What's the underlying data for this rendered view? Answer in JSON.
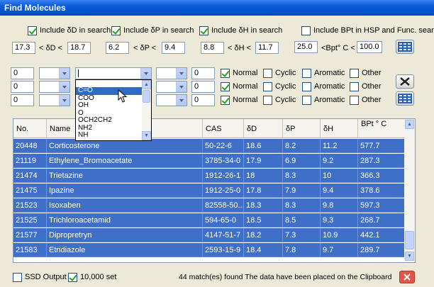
{
  "window": {
    "title": "Find Molecules"
  },
  "options": {
    "include_d": "Include δD in search",
    "include_p": "Include δP in search",
    "include_h": "Include δH in search",
    "include_bpt": "Include BPt in HSP and Func. search"
  },
  "ranges": {
    "d_min": "17.3",
    "d_label": "< δD <",
    "d_max": "18.7",
    "p_min": "6.2",
    "p_label": "< δP <",
    "p_max": "9.4",
    "h_min": "8.8",
    "h_label": "< δH <",
    "h_max": "11.7",
    "bpt_min": "25.0",
    "bpt_label": "<Bpt° C <",
    "bpt_max": "100.0"
  },
  "groups": [
    {
      "count": "0",
      "group": "",
      "count2": "0",
      "normal": "Normal",
      "cyclic": "Cyclic",
      "aromatic": "Aromatic",
      "other": "Other"
    },
    {
      "count": "0",
      "group": "",
      "count2": "0",
      "normal": "Normal",
      "cyclic": "Cyclic",
      "aromatic": "Aromatic",
      "other": "Other"
    },
    {
      "count": "0",
      "group": "",
      "count2": "0",
      "normal": "Normal",
      "cyclic": "Cyclic",
      "aromatic": "Aromatic",
      "other": "Other"
    }
  ],
  "dropdown_options": [
    "C=O",
    "COO",
    "OH",
    "O",
    "OCH2CH2",
    "NH2",
    "NH"
  ],
  "table": {
    "columns": [
      "No.",
      "Name",
      "CAS",
      "δD",
      "δP",
      "δH",
      "BPt ° C"
    ],
    "rows": [
      [
        "20448",
        "Corticosterone",
        "50-22-6",
        "18.6",
        "8.2",
        "11.2",
        "577.7"
      ],
      [
        "21119",
        "Ethylene_Bromoacetate",
        "3785-34-0",
        "17.9",
        "6.9",
        "9.2",
        "287.3"
      ],
      [
        "21474",
        "Trietazine",
        "1912-26-1",
        "18",
        "8.3",
        "10",
        "366.3"
      ],
      [
        "21475",
        "Ipazine",
        "1912-25-0",
        "17.8",
        "7.9",
        "9.4",
        "378.6"
      ],
      [
        "21523",
        "Isoxaben",
        "82558-50...",
        "18.3",
        "8.3",
        "9.8",
        "597.3"
      ],
      [
        "21525",
        "Trichloroacetamid",
        "594-65-0",
        "18.5",
        "8.5",
        "9.3",
        "268.7"
      ],
      [
        "21577",
        "Dipropretryn",
        "4147-51-7",
        "18.2",
        "7.3",
        "10.9",
        "442.1"
      ],
      [
        "21583",
        "Etridiazole",
        "2593-15-9",
        "18.4",
        "7.8",
        "9.7",
        "289.7"
      ]
    ]
  },
  "footer": {
    "ssd_output": "SSD Output",
    "set_10000": "10,000 set",
    "status": "44 match(es) found  The data have been placed on the Clipboard"
  }
}
